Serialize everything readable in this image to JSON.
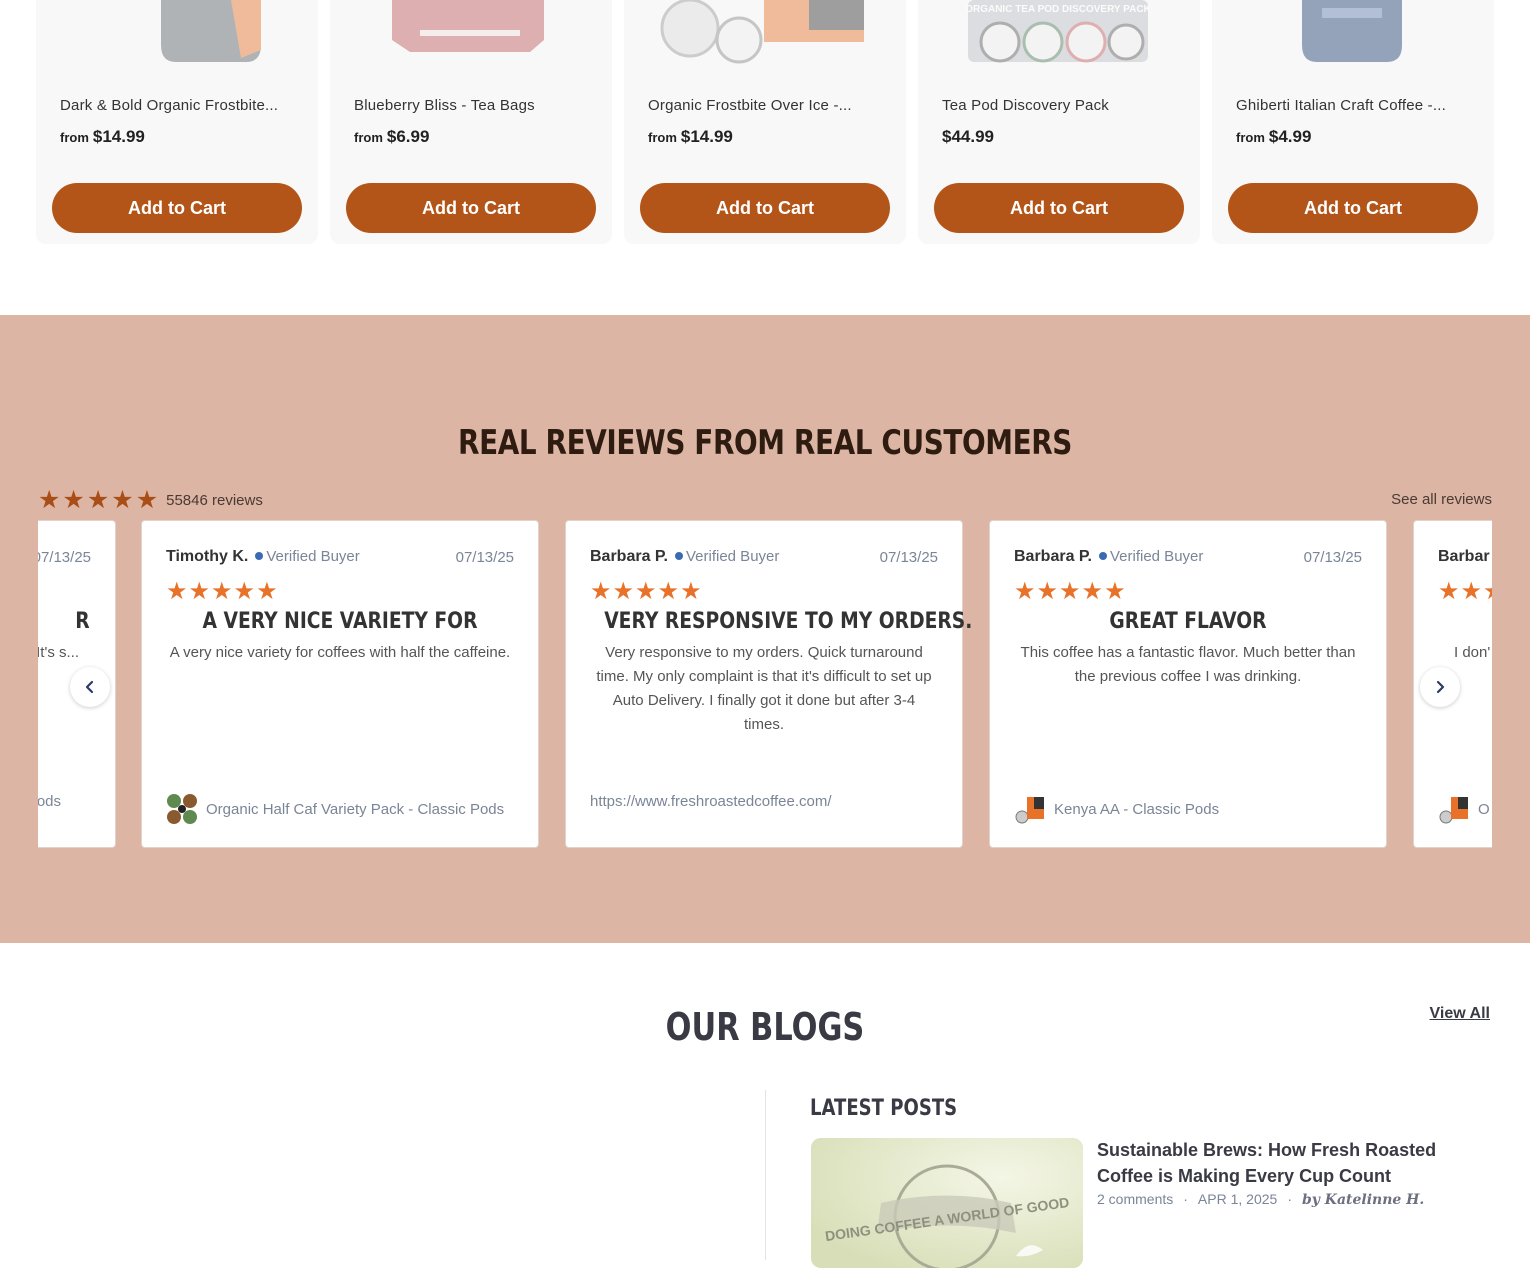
{
  "products": [
    {
      "name": "Dark & Bold Organic Frostbite...",
      "from": "from",
      "price": "$14.99",
      "cta": "Add to Cart"
    },
    {
      "name": "Blueberry Bliss - Tea Bags",
      "from": "from",
      "price": "$6.99",
      "cta": "Add to Cart"
    },
    {
      "name": "Organic Frostbite Over Ice -...",
      "from": "from",
      "price": "$14.99",
      "cta": "Add to Cart"
    },
    {
      "name": "Tea Pod Discovery Pack",
      "from": "",
      "price": "$44.99",
      "cta": "Add to Cart",
      "image_text": "ORGANIC TEA POD DISCOVERY PACK"
    },
    {
      "name": "Ghiberti Italian Craft Coffee -...",
      "from": "from",
      "price": "$4.99",
      "cta": "Add to Cart"
    }
  ],
  "reviews_section": {
    "title": "REAL REVIEWS FROM REAL CUSTOMERS",
    "rating": 5,
    "count_label": "55846 reviews",
    "see_all": "See all reviews",
    "verified_label": "Verified Buyer",
    "cards": [
      {
        "name": "",
        "date": "07/13/25",
        "headline": "R",
        "body": "...t you ... It's s...",
        "product": "...ods"
      },
      {
        "name": "Timothy K.",
        "date": "07/13/25",
        "headline": "A VERY NICE VARIETY FOR",
        "body": "A very nice variety for coffees with half the caffeine.",
        "product": "Organic Half Caf Variety Pack - Classic Pods"
      },
      {
        "name": "Barbara P.",
        "date": "07/13/25",
        "headline": "VERY RESPONSIVE TO MY ORDERS.",
        "body": "Very responsive to my orders. Quick turnaround time. My only complaint is that it's difficult to set up Auto Delivery. I finally got it done but after 3-4 times.",
        "product": "https://www.freshroastedcoffee.com/"
      },
      {
        "name": "Barbara P.",
        "date": "07/13/25",
        "headline": "GREAT FLAVOR",
        "body": "This coffee has a fantastic flavor. Much better than the previous coffee I was drinking.",
        "product": "Kenya AA - Classic Pods"
      },
      {
        "name": "Barbar",
        "date": "",
        "headline": "",
        "body": "I don' ... ally g",
        "product": "O"
      }
    ]
  },
  "blogs": {
    "title": "OUR BLOGS",
    "view_all": "View All",
    "latest_heading": "LATEST POSTS",
    "post": {
      "title": "Sustainable Brews: How Fresh Roasted Coffee is Making Every Cup Count",
      "comments": "2 comments",
      "date": "APR 1, 2025",
      "author": "by Katelinne H.",
      "image_text": "DOING COFFEE A WORLD OF GOOD"
    }
  },
  "colors": {
    "accent": "#b35518",
    "reviews_bg": "#ddb5a4",
    "star": "#e8722a",
    "summary_star": "#a94e17"
  },
  "icons": [
    "star-icon",
    "verified-badge-icon",
    "chevron-left-icon",
    "chevron-right-icon"
  ]
}
